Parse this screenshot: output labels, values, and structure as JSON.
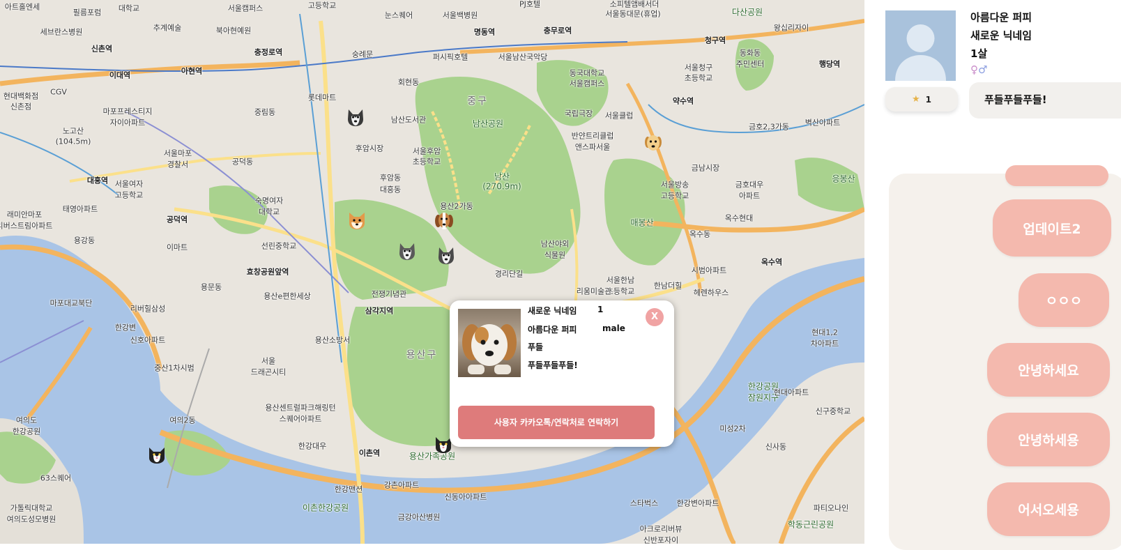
{
  "map": {
    "districts": [
      "중구",
      "용산구"
    ],
    "labels": [
      {
        "t": "아트홀엔세",
        "k": "poi"
      },
      {
        "t": "필름포럼",
        "k": "poi"
      },
      {
        "t": "대학교",
        "k": "poi"
      },
      {
        "t": "서울캠퍼스",
        "k": "poi"
      },
      {
        "t": "고등학교",
        "k": "poi"
      },
      {
        "t": "눈스퀘어",
        "k": "poi"
      },
      {
        "t": "서울백병원",
        "k": "poi"
      },
      {
        "t": "PJ호텔",
        "k": "poi"
      },
      {
        "t": "소피텔앰배서더",
        "k": "poi"
      },
      {
        "t": "서울동대문(휴업)",
        "k": "poi"
      },
      {
        "t": "다산공원",
        "k": "park"
      },
      {
        "t": "세브란스병원",
        "k": "poi"
      },
      {
        "t": "추계예술",
        "k": "poi"
      },
      {
        "t": "북아현예원",
        "k": "poi"
      },
      {
        "t": "명동역",
        "k": "station"
      },
      {
        "t": "충무로역",
        "k": "station"
      },
      {
        "t": "왕십리자이",
        "k": "poi"
      },
      {
        "t": "신촌역",
        "k": "station"
      },
      {
        "t": "충정로역",
        "k": "station"
      },
      {
        "t": "숭례문",
        "k": "poi"
      },
      {
        "t": "퍼시픽호텔",
        "k": "poi"
      },
      {
        "t": "서울남산국악당",
        "k": "poi"
      },
      {
        "t": "청구역",
        "k": "station"
      },
      {
        "t": "동화동",
        "k": "poi"
      },
      {
        "t": "주민센터",
        "k": "poi"
      },
      {
        "t": "이대역",
        "k": "station"
      },
      {
        "t": "아현역",
        "k": "station"
      },
      {
        "t": "회현동",
        "k": "poi"
      },
      {
        "t": "동국대학교",
        "k": "poi"
      },
      {
        "t": "서울캠퍼스",
        "k": "poi"
      },
      {
        "t": "서울청구",
        "k": "poi"
      },
      {
        "t": "초등학교",
        "k": "poi"
      },
      {
        "t": "행당역",
        "k": "station"
      },
      {
        "t": "CGV",
        "k": "poi"
      },
      {
        "t": "롯데마트",
        "k": "poi"
      },
      {
        "t": "현대백화점",
        "k": "poi"
      },
      {
        "t": "신촌점",
        "k": "poi"
      },
      {
        "t": "마포프레스티지",
        "k": "poi"
      },
      {
        "t": "자이아파트",
        "k": "poi"
      },
      {
        "t": "중림동",
        "k": "poi"
      },
      {
        "t": "남산도서관",
        "k": "poi"
      },
      {
        "t": "국립극장",
        "k": "poi"
      },
      {
        "t": "서울클럽",
        "k": "poi"
      },
      {
        "t": "약수역",
        "k": "station"
      },
      {
        "t": "금호2,3가동",
        "k": "poi"
      },
      {
        "t": "벽산아파트",
        "k": "poi"
      },
      {
        "t": "노고산",
        "k": "poi"
      },
      {
        "t": "(104.5m)",
        "k": "poi"
      },
      {
        "t": "남산공원",
        "k": "park"
      },
      {
        "t": "반얀트리클럽",
        "k": "poi"
      },
      {
        "t": "앤스파서울",
        "k": "poi"
      },
      {
        "t": "서울마포",
        "k": "poi"
      },
      {
        "t": "경찰서",
        "k": "poi"
      },
      {
        "t": "후암시장",
        "k": "poi"
      },
      {
        "t": "서울후암",
        "k": "poi"
      },
      {
        "t": "초등학교",
        "k": "poi"
      },
      {
        "t": "공덕동",
        "k": "poi"
      },
      {
        "t": "남산",
        "k": "park"
      },
      {
        "t": "(270.9m)",
        "k": "park"
      },
      {
        "t": "금남시장",
        "k": "poi"
      },
      {
        "t": "대흥역",
        "k": "station"
      },
      {
        "t": "서울여자",
        "k": "poi"
      },
      {
        "t": "고등학교",
        "k": "poi"
      },
      {
        "t": "후암동",
        "k": "poi"
      },
      {
        "t": "서울방송",
        "k": "poi"
      },
      {
        "t": "고등학교",
        "k": "poi"
      },
      {
        "t": "금호대우",
        "k": "poi"
      },
      {
        "t": "아파트",
        "k": "poi"
      },
      {
        "t": "응봉산",
        "k": "park"
      },
      {
        "t": "대흥동",
        "k": "poi"
      },
      {
        "t": "태영아파트",
        "k": "poi"
      },
      {
        "t": "숙명여자",
        "k": "poi"
      },
      {
        "t": "대학교",
        "k": "poi"
      },
      {
        "t": "용산2가동",
        "k": "poi"
      },
      {
        "t": "래미안마포",
        "k": "poi"
      },
      {
        "t": "리버스트림아파트",
        "k": "poi"
      },
      {
        "t": "공덕역",
        "k": "station"
      },
      {
        "t": "매봉산",
        "k": "park"
      },
      {
        "t": "옥수현대",
        "k": "poi"
      },
      {
        "t": "옥수동",
        "k": "poi"
      },
      {
        "t": "용강동",
        "k": "poi"
      },
      {
        "t": "이마트",
        "k": "poi"
      },
      {
        "t": "선린중학교",
        "k": "poi"
      },
      {
        "t": "남산야외",
        "k": "poi"
      },
      {
        "t": "식물원",
        "k": "poi"
      },
      {
        "t": "경리단길",
        "k": "poi"
      },
      {
        "t": "옥수역",
        "k": "station"
      },
      {
        "t": "효창공원앞역",
        "k": "station"
      },
      {
        "t": "서울한남",
        "k": "poi"
      },
      {
        "t": "초등학교",
        "k": "poi"
      },
      {
        "t": "한남더힐",
        "k": "poi"
      },
      {
        "t": "시범아파트",
        "k": "poi"
      },
      {
        "t": "마포대교북단",
        "k": "poi"
      },
      {
        "t": "용문동",
        "k": "poi"
      },
      {
        "t": "용산e편한세상",
        "k": "poi"
      },
      {
        "t": "전쟁기념관",
        "k": "poi"
      },
      {
        "t": "리움미술관",
        "k": "poi"
      },
      {
        "t": "헤렌하우스",
        "k": "poi"
      },
      {
        "t": "리버힐삼성",
        "k": "poi"
      },
      {
        "t": "삼각지역",
        "k": "station"
      },
      {
        "t": "한강변",
        "k": "poi"
      },
      {
        "t": "신호아파트",
        "k": "poi"
      },
      {
        "t": "용산소방서",
        "k": "poi"
      },
      {
        "t": "현대1,2",
        "k": "poi"
      },
      {
        "t": "차아파트",
        "k": "poi"
      },
      {
        "t": "서울",
        "k": "poi"
      },
      {
        "t": "드래곤시티",
        "k": "poi"
      },
      {
        "t": "중산1차시범",
        "k": "poi"
      },
      {
        "t": "한강공원",
        "k": "park"
      },
      {
        "t": "잠원지구",
        "k": "park"
      },
      {
        "t": "현대아파트",
        "k": "poi"
      },
      {
        "t": "용산센트럴파크해링턴",
        "k": "poi"
      },
      {
        "t": "스퀘어아파트",
        "k": "poi"
      },
      {
        "t": "여의도",
        "k": "poi"
      },
      {
        "t": "한강공원",
        "k": "poi"
      },
      {
        "t": "여의2동",
        "k": "poi"
      },
      {
        "t": "신구중학교",
        "k": "poi"
      },
      {
        "t": "한강대우",
        "k": "poi"
      },
      {
        "t": "이촌역",
        "k": "station"
      },
      {
        "t": "용산가족공원",
        "k": "park"
      },
      {
        "t": "미성2차",
        "k": "poi"
      },
      {
        "t": "신사동",
        "k": "poi"
      },
      {
        "t": "63스퀘어",
        "k": "poi"
      },
      {
        "t": "한강맨션",
        "k": "poi"
      },
      {
        "t": "강촌아파트",
        "k": "poi"
      },
      {
        "t": "신동아아파트",
        "k": "poi"
      },
      {
        "t": "가톨릭대학교",
        "k": "poi"
      },
      {
        "t": "여의도성모병원",
        "k": "poi"
      },
      {
        "t": "이촌한강공원",
        "k": "park"
      },
      {
        "t": "금강아산병원",
        "k": "poi"
      },
      {
        "t": "스타벅스",
        "k": "poi"
      },
      {
        "t": "한강변아파트",
        "k": "poi"
      },
      {
        "t": "파티오나인",
        "k": "poi"
      },
      {
        "t": "학동근린공원",
        "k": "park"
      },
      {
        "t": "아크로리버뷰",
        "k": "poi"
      },
      {
        "t": "신반포자이",
        "k": "poi"
      }
    ]
  },
  "popup": {
    "nickname": "새로운 닉네임",
    "age": "1",
    "pet_name": "아름다운 퍼피",
    "gender": "male",
    "breed": "푸들",
    "status": "푸들푸들푸들!",
    "close_label": "X",
    "contact_button": "사용자 카카오톡/연락처로 연락하기"
  },
  "profile": {
    "pet_name": "아름다운 퍼피",
    "nickname": "새로운 닉네임",
    "age": "1살",
    "gender_female": "♀",
    "gender_male": "♂",
    "star_count": "1",
    "status": "푸들푸들푸들!"
  },
  "chat": {
    "messages": [
      "업데이트2",
      "ㅇㅇㅇ",
      "안녕하세요",
      "안녕하세용",
      "어서오세용"
    ]
  },
  "colors": {
    "water": "#a9c4e6",
    "park": "#a9d28e",
    "road_major": "#f3b45e",
    "bubble": "#f4b9ae",
    "contact_button": "#de7b7b"
  }
}
